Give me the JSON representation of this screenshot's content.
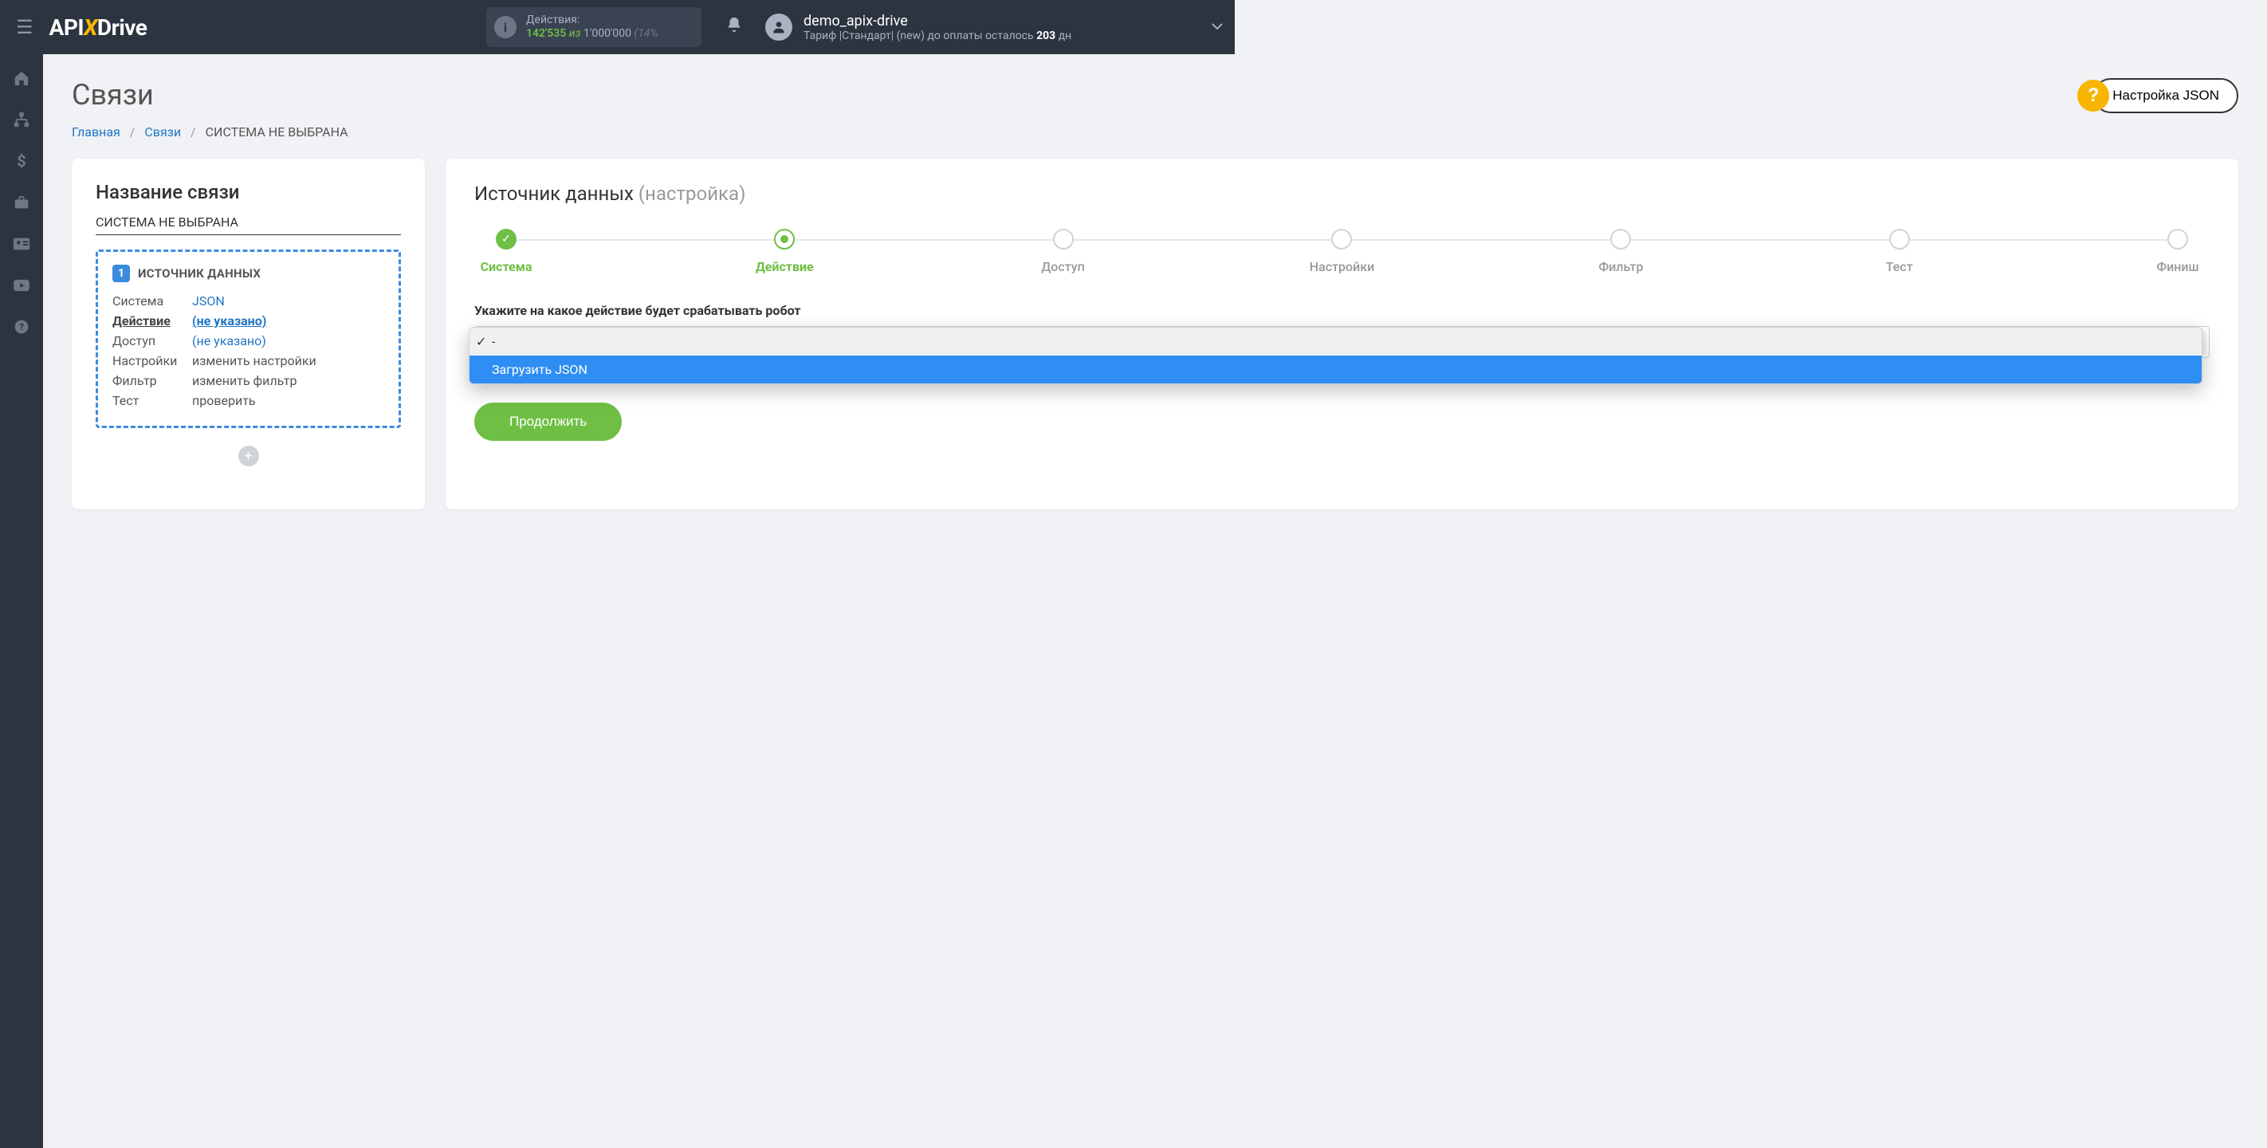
{
  "header": {
    "logo_pre": "API",
    "logo_x": "X",
    "logo_post": "Drive",
    "actions_label": "Действия:",
    "actions_used": "142'535",
    "actions_of": "из",
    "actions_total": "1'000'000",
    "actions_pct": "(14%",
    "username": "demo_apix-drive",
    "tariff_pre": "Тариф |Стандарт| (new) до оплаты осталось ",
    "tariff_days": "203",
    "tariff_post": " дн"
  },
  "page": {
    "title": "Связи",
    "json_button": "Настройка JSON"
  },
  "breadcrumb": {
    "home": "Главная",
    "links": "Связи",
    "current": "СИСТЕМА НЕ ВЫБРАНА"
  },
  "left": {
    "title": "Название связи",
    "system_name": "СИСТЕМА НЕ ВЫБРАНА",
    "step_num": "1",
    "step_title": "ИСТОЧНИК ДАННЫХ",
    "rows": {
      "system_k": "Система",
      "system_v": "JSON",
      "action_k": "Действие",
      "action_v": "(не указано)",
      "access_k": "Доступ",
      "access_v": "(не указано)",
      "settings_k": "Настройки",
      "settings_v": "изменить настройки",
      "filter_k": "Фильтр",
      "filter_v": "изменить фильтр",
      "test_k": "Тест",
      "test_v": "проверить"
    }
  },
  "right": {
    "title": "Источник данных",
    "subtitle": "(настройка)",
    "steps": {
      "s1": "Система",
      "s2": "Действие",
      "s3": "Доступ",
      "s4": "Настройки",
      "s5": "Фильтр",
      "s6": "Тест",
      "s7": "Финиш"
    },
    "field_label": "Укажите на какое действие будет срабатывать робот",
    "dropdown": {
      "placeholder": "-",
      "option": "Загрузить JSON"
    },
    "continue": "Продолжить"
  }
}
